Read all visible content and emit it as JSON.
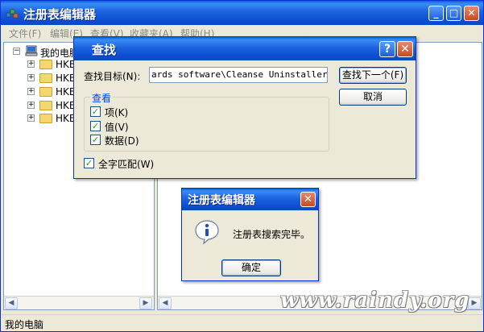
{
  "main": {
    "title": "注册表编辑器",
    "menu": [
      "文件(F)",
      "编辑(E)",
      "查看(V)",
      "收藏夹(A)",
      "帮助(H)"
    ],
    "tree": {
      "root": "我的电脑",
      "items": [
        "HKEY",
        "HKEY",
        "HKEY",
        "HKEY",
        "HKEY"
      ]
    },
    "status": "我的电脑",
    "window_buttons": {
      "min": "_",
      "max": "□",
      "close": "✕"
    }
  },
  "find_dialog": {
    "title": "查找",
    "target_label": "查找目标(N):",
    "target_value": "ards software\\Cleanse Uninstaller Pro",
    "find_next": "查找下一个(F)",
    "cancel": "取消",
    "look_group": "查看",
    "options": [
      {
        "label": "项(K)",
        "checked": true
      },
      {
        "label": "值(V)",
        "checked": true
      },
      {
        "label": "数据(D)",
        "checked": true
      }
    ],
    "whole_match": {
      "label": "全字匹配(W)",
      "checked": true
    },
    "help": "?",
    "close": "✕"
  },
  "message_dialog": {
    "title": "注册表编辑器",
    "text": "注册表搜索完毕。",
    "ok": "确定",
    "close": "✕"
  },
  "watermark": "www.raindy.org",
  "icons": [
    "regedit-icon",
    "computer-icon",
    "folder-icon",
    "info-icon",
    "checkbox-check-icon",
    "scroll-left-icon",
    "scroll-right-icon"
  ]
}
